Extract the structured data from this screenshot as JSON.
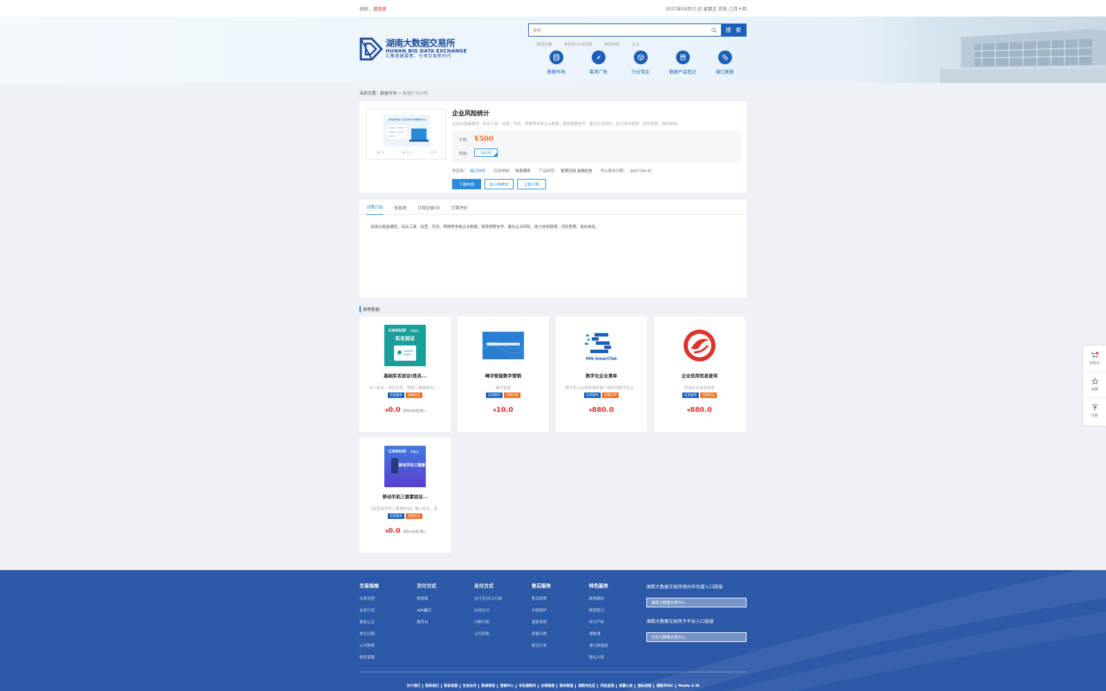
{
  "topbar": {
    "greeting": "你好，",
    "login": "请登录",
    "date": "2025年04月11日 星期五 农历 三月十四"
  },
  "logo": {
    "cn": "湖南大数据交易所",
    "en": "HUNAN BIG DATA EXCHANGE",
    "slogan": "汇聚数据要素，引领交易新时代"
  },
  "search": {
    "placeholder": "搜索",
    "button": "搜 索",
    "hot": [
      "港湾交通",
      "身份证OCR识别",
      "物流信息",
      "企业"
    ]
  },
  "nav": [
    {
      "label": "数据市场",
      "icon": "database-icon"
    },
    {
      "label": "需求广场",
      "icon": "compass-icon"
    },
    {
      "label": "行业专区",
      "icon": "cube-icon"
    },
    {
      "label": "数据产品登记",
      "icon": "coin-stack-icon"
    },
    {
      "label": "湘江数链",
      "icon": "link-icon"
    }
  ],
  "breadcrumb": {
    "prefix": "当前位置：数据市场",
    "sep": " > ",
    "current": "数据产品详情"
  },
  "product": {
    "title": "企业风险统计",
    "desc": "运用AI智能模型，综合工商、经营、司法、舆情等多维企业数据，提炼预警信号，量化企业风险，助力信用管理、风险管理，授信审批。",
    "thumb_title": "某某数智科技 企业风险统计数据服务平台",
    "stats": [
      "0",
      "11",
      "0"
    ],
    "price_label": "价格：",
    "price": "¥500",
    "spec_label": "规格：",
    "spec": "365天",
    "supplier_label": "供应商：",
    "supplier": "福马科技",
    "industry_label": "应用领域：",
    "industry": "信息服务",
    "tags_label": "产品标签：",
    "tags": "智慧应用,金融征信",
    "end_label": "停止服务日期：",
    "end": "2027-03-31",
    "actions": {
      "download": "下载样例",
      "cart": "加入购物车",
      "buy": "立即订购"
    }
  },
  "tabs": [
    "详情介绍",
    "信息项",
    "订阅记录(0)",
    "订单评价"
  ],
  "detail_text": "运用AI智能模型，综合工商、经营、司法、舆情等多维企业数据，提炼预警信号，量化企业风险，助力信用管理、风险管理，授信审批。",
  "recommend": {
    "title": "推荐数据",
    "items": [
      {
        "name": "基础实名验证(姓名...",
        "desc": "传入姓名，身份证号，数据二要素是否一...",
        "tags": [
          "信息服务",
          "金融征信"
        ],
        "price": "0.0",
        "sub": "(约0.00元/次)"
      },
      {
        "name": "峰华智能数字营销",
        "desc": "峰华智能",
        "tags": [
          "信息服务",
          "智慧应用"
        ],
        "price": "10.0",
        "sub": ""
      },
      {
        "name": "数字化企业清单",
        "desc": "数字化企业清单服务是一种利用数字化企...",
        "tags": [
          "信息服务",
          "智慧应用"
        ],
        "price": "880.0",
        "sub": ""
      },
      {
        "name": "企业信用信息查询",
        "desc": "查询企业信用信息",
        "tags": [
          "信息服务",
          "金融征信"
        ],
        "price": "880.0",
        "sub": ""
      },
      {
        "name": "移动手机三要素验证...",
        "desc": "【运营商手机三要素核验】输入姓名，身...",
        "tags": [
          "信息服务",
          "金融征信"
        ],
        "price": "0.0",
        "sub": "(约0.00元/次)"
      }
    ],
    "img_text": {
      "brand": "CANSID",
      "brand2": "科能达",
      "card1": "实名验证",
      "card5": "移动手机三要素",
      "logo3": "MN-SmartTek"
    }
  },
  "float": {
    "cart": "购物车",
    "cart_count": "0",
    "fav": "收藏",
    "top": "顶部"
  },
  "footer": {
    "cols": [
      {
        "h": "交易指南",
        "l": [
          "交易流程",
          "会员介绍",
          "数商认证",
          "常见问题",
          "公共数据",
          "联系客服"
        ]
      },
      {
        "h": "交付方式",
        "l": [
          "数据集",
          "API接口",
          "服务包"
        ]
      },
      {
        "h": "支付方式",
        "l": [
          "支付宝/对公付款",
          "在线支付",
          "分期付款",
          "公司转账"
        ]
      },
      {
        "h": "售后服务",
        "l": [
          "售后政策",
          "价格保护",
          "退款说明",
          "质量问题",
          "取消订单"
        ]
      },
      {
        "h": "特色服务",
        "l": [
          "数据确权",
          "数据登记",
          "知识产权",
          "湘数通",
          "湘江数据链",
          "隐私计算"
        ]
      }
    ],
    "right": {
      "t1": "湖南大数据交易所地州市共建入口链接",
      "s1": "湖南大数据交易中心",
      "t2": "湖南大数据交易所子平台入口链接",
      "s2": "文化大数据交易中心"
    },
    "links": [
      "关于我们",
      "联系我们",
      "联系客服",
      "生态合作",
      "数商帮助",
      "营销中心",
      "手机湘数所",
      "友情链接",
      "数所联盟",
      "湘数所社区",
      "风险监测",
      "质量公告",
      "隐私政策",
      "湘数所IDC",
      "Media & IR"
    ]
  }
}
